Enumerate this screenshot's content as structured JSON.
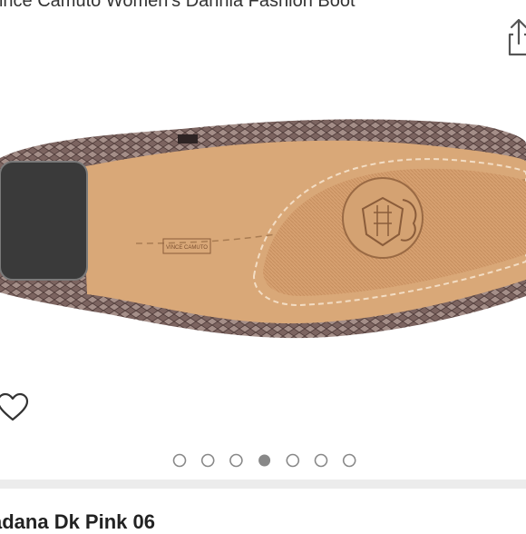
{
  "header": {
    "title": "Vince Camuto Women's Dannia Fashion Boot"
  },
  "icons": {
    "share": "share-icon",
    "favorite": "heart-outline-icon"
  },
  "product": {
    "brand_stamp": "VINCE CAMUTO"
  },
  "carousel": {
    "total": 7,
    "active_index": 3,
    "dot_color": "#888888",
    "active_color": "#888888"
  },
  "footer": {
    "partial_text": "adana Dk Pink 06"
  },
  "colors": {
    "sole": "#d9a878",
    "heel": "#3a3a3a",
    "upper": "#8a7068"
  }
}
